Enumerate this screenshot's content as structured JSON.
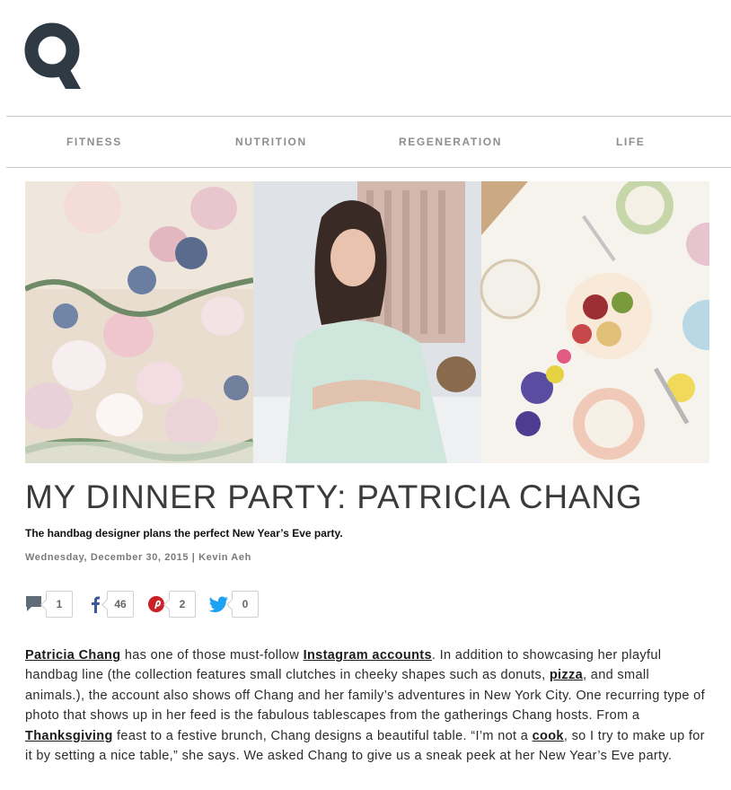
{
  "brand": {
    "logo_letter": "Q",
    "logo_color": "#2f3a44"
  },
  "nav": {
    "items": [
      {
        "label": "FITNESS"
      },
      {
        "label": "NUTRITION"
      },
      {
        "label": "REGENERATION"
      },
      {
        "label": "LIFE"
      }
    ]
  },
  "hero": {
    "panels": [
      "flowers-photo",
      "portrait-photo",
      "table-setting-photo"
    ]
  },
  "article": {
    "title": "MY DINNER PARTY: PATRICIA CHANG",
    "subtitle": "The handbag designer plans the perfect New Year’s Eve party.",
    "date": "Wednesday, December 30, 2015",
    "separator": " | ",
    "author": "Kevin Aeh"
  },
  "share": {
    "comments": {
      "icon": "comment-icon",
      "count": "1"
    },
    "facebook": {
      "icon": "facebook-icon",
      "count": "46",
      "color": "#3b5998"
    },
    "pinterest": {
      "icon": "pinterest-icon",
      "count": "2",
      "color": "#cb2027"
    },
    "twitter": {
      "icon": "twitter-icon",
      "count": "0",
      "color": "#1da1f2"
    }
  },
  "body": {
    "link_patricia": "Patricia Chang",
    "t1": " has one of those must-follow ",
    "link_instagram": "Instagram accounts",
    "t2": ". In addition to showcasing her playful handbag line (the collection features small clutches in cheeky shapes such as donuts, ",
    "link_pizza": "pizza",
    "t3": ", and small animals.), the account also shows off Chang and her family’s adventures in New York City. One recurring type of photo that shows up in her feed is the fabulous tablescapes from the gatherings Chang hosts. From a ",
    "link_thanksgiving": "Thanksgiving",
    "t4": " feast to a festive brunch, Chang designs a beautiful table. “I’m not a ",
    "link_cook": "cook",
    "t5": ", so I try to make up for it by setting a nice table,” she says. We asked Chang to give us a sneak peek at her New Year’s Eve party."
  }
}
